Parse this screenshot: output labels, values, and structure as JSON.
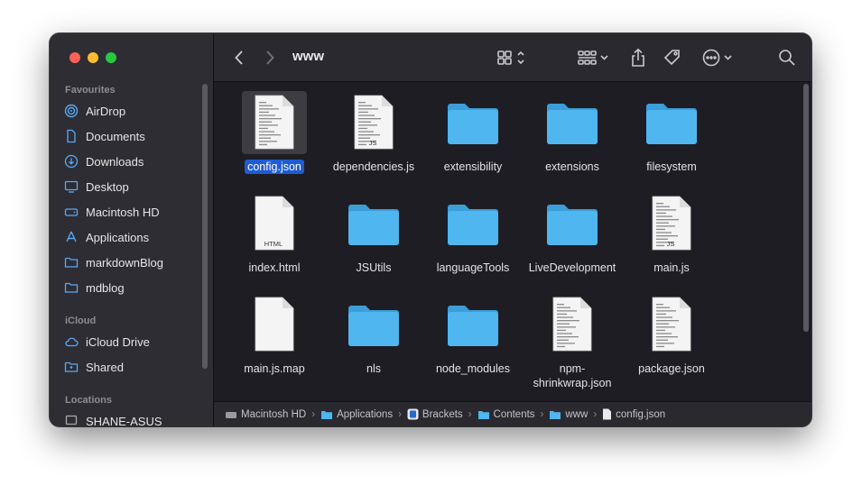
{
  "toolbar": {
    "title": "www"
  },
  "sidebar": {
    "favourites_heading": "Favourites",
    "favourites": [
      {
        "label": "AirDrop",
        "icon": "airdrop-icon"
      },
      {
        "label": "Documents",
        "icon": "document-icon"
      },
      {
        "label": "Downloads",
        "icon": "download-icon"
      },
      {
        "label": "Desktop",
        "icon": "desktop-icon"
      },
      {
        "label": "Macintosh HD",
        "icon": "harddrive-icon"
      },
      {
        "label": "Applications",
        "icon": "applications-icon"
      },
      {
        "label": "markdownBlog",
        "icon": "folder-icon"
      },
      {
        "label": "mdblog",
        "icon": "folder-icon"
      }
    ],
    "icloud_heading": "iCloud",
    "icloud": [
      {
        "label": "iCloud Drive",
        "icon": "cloud-icon"
      },
      {
        "label": "Shared",
        "icon": "shared-folder-icon"
      }
    ],
    "locations_heading": "Locations",
    "locations": [
      {
        "label": "SHANE-ASUS",
        "icon": "computer-icon"
      }
    ]
  },
  "files": [
    {
      "name": "config.json",
      "kind": "doc",
      "selected": true
    },
    {
      "name": "dependencies.js",
      "kind": "js",
      "badge": "JS"
    },
    {
      "name": "extensibility",
      "kind": "folder"
    },
    {
      "name": "extensions",
      "kind": "folder"
    },
    {
      "name": "filesystem",
      "kind": "folder"
    },
    {
      "name": "index.html",
      "kind": "html",
      "badge": "HTML"
    },
    {
      "name": "JSUtils",
      "kind": "folder"
    },
    {
      "name": "languageTools",
      "kind": "folder"
    },
    {
      "name": "LiveDevelopment",
      "kind": "folder"
    },
    {
      "name": "main.js",
      "kind": "js",
      "badge": "JS"
    },
    {
      "name": "main.js.map",
      "kind": "blank"
    },
    {
      "name": "nls",
      "kind": "folder"
    },
    {
      "name": "node_modules",
      "kind": "folder"
    },
    {
      "name": "npm-shrinkwrap.json",
      "kind": "doc",
      "line1": "npm-",
      "line2": "shrinkwrap.json"
    },
    {
      "name": "package.json",
      "kind": "doc"
    }
  ],
  "pathbar": {
    "crumbs": [
      "Macintosh HD",
      "Applications",
      "Brackets",
      "Contents",
      "www",
      "config.json"
    ]
  },
  "colors": {
    "folder": "#4fb6ef",
    "selection": "#1f5bd6"
  }
}
